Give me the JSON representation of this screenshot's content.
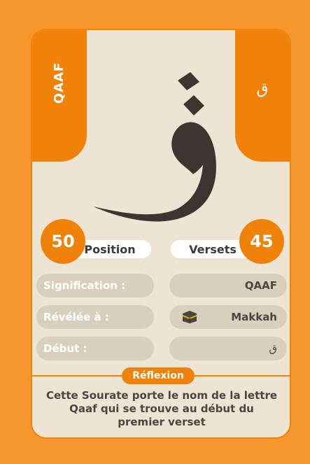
{
  "card": {
    "name_vertical": "QAAF",
    "side_glyph": "ق",
    "big_letter": "ق",
    "position_value": "50",
    "position_label": "Position",
    "verses_label": "Versets",
    "verses_value": "45",
    "rows": [
      {
        "label": "Signification :",
        "value": "QAAF"
      },
      {
        "label": "Révélée à :",
        "value": "Makkah"
      },
      {
        "label": "Début :",
        "value": "ق"
      }
    ],
    "reflexion_label": "Réflexion",
    "reflexion_text": "Cette Sourate porte le nom de la lettre Qaaf qui se trouve au début du premier verset"
  },
  "colors": {
    "background": "#f7962d",
    "card": "#ede4d3",
    "accent": "#f0820a",
    "row_fill": "#d9cfbd",
    "text_dark": "#4a4540"
  }
}
